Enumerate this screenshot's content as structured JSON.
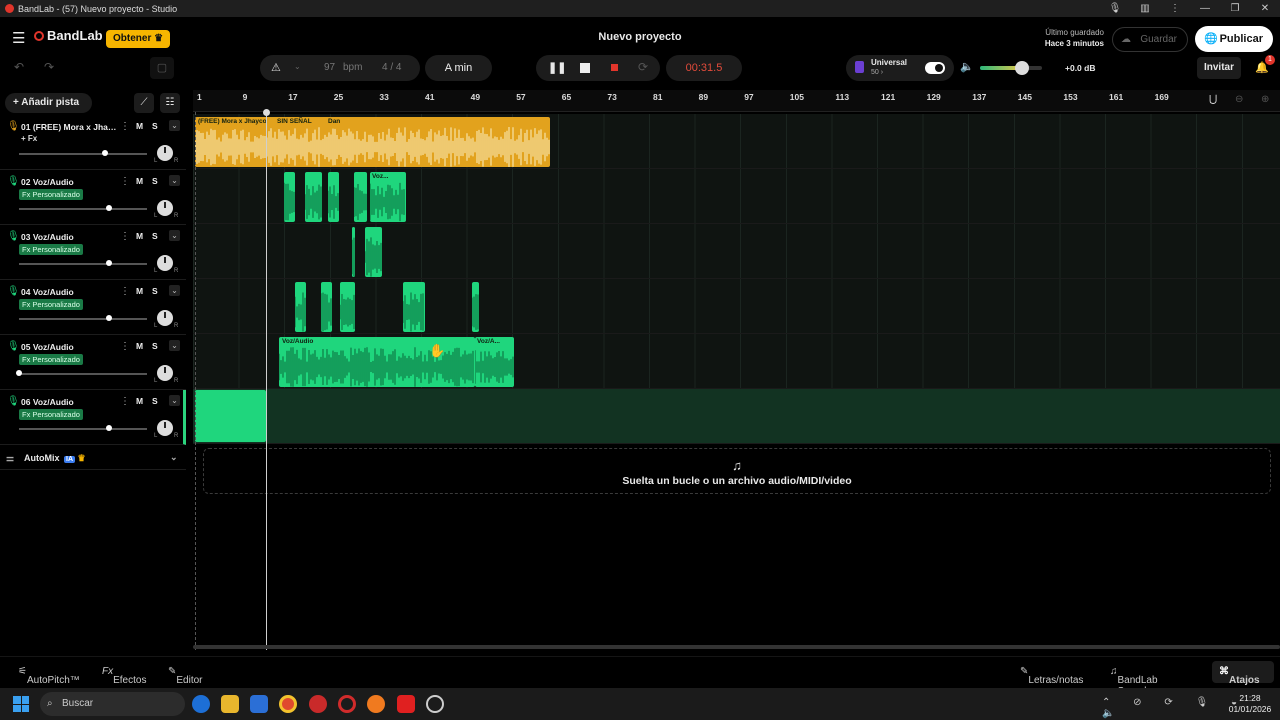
{
  "window": {
    "title": "BandLab - (57) Nuevo proyecto - Studio"
  },
  "header": {
    "logo": "BandLab",
    "obtener": "Obtener",
    "project_title": "Nuevo proyecto",
    "saved_label": "Último guardado",
    "saved_time": "Hace 3 minutos",
    "guardar": "Guardar",
    "publicar": "Publicar"
  },
  "transport": {
    "bpm_value": "97",
    "bpm_unit": "bpm",
    "time_sig": "4 / 4",
    "key": "A min",
    "time": "00:31.5",
    "universal_label": "Universal",
    "universal_value": "50",
    "volume_db": "+0.0 dB",
    "volume_level": 0.68,
    "invitar": "Invitar",
    "notification_count": "1"
  },
  "left": {
    "add_track": "Añadir pista",
    "tracks": [
      {
        "name": "01  (FREE) Mora x Jhay...",
        "fx": "+ Fx",
        "fx_badge": false,
        "volume": 0.67,
        "color": "#e2a21d"
      },
      {
        "name": "02  Voz/Audio",
        "fx": "Fx Personalizado",
        "fx_badge": true,
        "volume": 0.7,
        "color": "#1fd67d"
      },
      {
        "name": "03  Voz/Audio",
        "fx": "Fx Personalizado",
        "fx_badge": true,
        "volume": 0.7,
        "color": "#1fd67d"
      },
      {
        "name": "04  Voz/Audio",
        "fx": "Fx Personalizado",
        "fx_badge": true,
        "volume": 0.7,
        "color": "#1fd67d"
      },
      {
        "name": "05  Voz/Audio",
        "fx": "Fx Personalizado",
        "fx_badge": true,
        "volume": 0.0,
        "color": "#1fd67d"
      },
      {
        "name": "06  Voz/Audio",
        "fx": "Fx Personalizado",
        "fx_badge": true,
        "volume": 0.7,
        "color": "#1fd67d"
      }
    ],
    "mute": "M",
    "solo": "S",
    "pan_l": "L",
    "pan_r": "R",
    "automix": "AutoMix",
    "ia": "IA"
  },
  "ruler": [
    "1",
    "9",
    "17",
    "25",
    "33",
    "41",
    "49",
    "57",
    "65",
    "73",
    "81",
    "89",
    "97",
    "105",
    "113",
    "121",
    "129",
    "137",
    "145",
    "153",
    "161",
    "169"
  ],
  "clip_labels": {
    "track1": [
      "(FREE) Mora x Jhayco",
      "SIN SEÑAL",
      "Dan"
    ],
    "track2": "Voz...",
    "track5a": "Voz/Audio",
    "track5b": "Voz/A..."
  },
  "dropzone": "Suelta un bucle o un archivo audio/MIDI/video",
  "bottom": {
    "autopitch": "AutoPitch™",
    "efectos": "Efectos",
    "editor": "Editor",
    "letras": "Letras/notas",
    "sounds": "BandLab Sounds",
    "atajos": "Atajos"
  },
  "taskbar": {
    "search": "Buscar",
    "time": "21:28",
    "date": "01/01/2026"
  }
}
